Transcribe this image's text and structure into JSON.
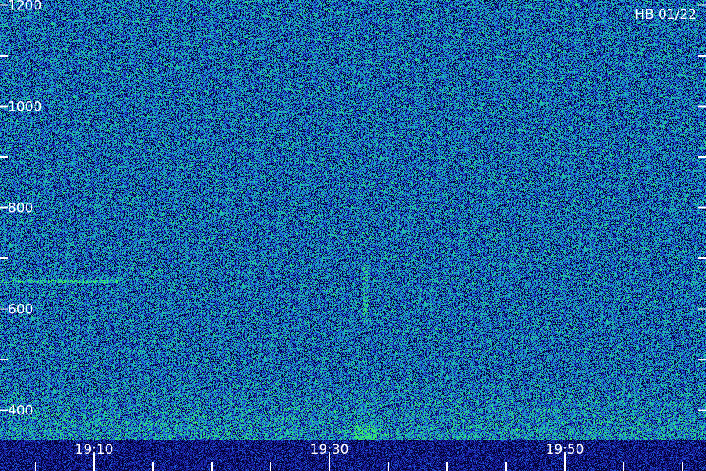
{
  "chart_data": {
    "type": "heatmap",
    "title": "",
    "corner_label": "HB 01/22",
    "xlabel": "",
    "ylabel": "",
    "y_tick_labels": [
      "1200",
      "1000",
      "800",
      "600",
      "400"
    ],
    "y_tick_values": [
      1200,
      1000,
      800,
      600,
      400
    ],
    "ylim": [
      280,
      1210
    ],
    "y_minor_step": 100,
    "x_tick_labels": [
      "19:10",
      "19:30",
      "19:50"
    ],
    "x_tick_values": [
      "19:10",
      "19:30",
      "19:50"
    ],
    "xlim": [
      "19:02",
      "20:02"
    ],
    "x_minor_step_minutes": 5,
    "grid": false,
    "colormap": [
      "#05053a",
      "#1a1fa0",
      "#1e5bd8",
      "#1aa0c8",
      "#22c8a0",
      "#3cf060"
    ],
    "features": [
      {
        "name": "",
        "type": "horizontal-line",
        "y": 655,
        "x_start": "19:02",
        "x_end": "19:12"
      },
      {
        "name": "",
        "type": "vertical-streak",
        "x": "19:33",
        "y_range": [
          570,
          690
        ]
      }
    ]
  }
}
